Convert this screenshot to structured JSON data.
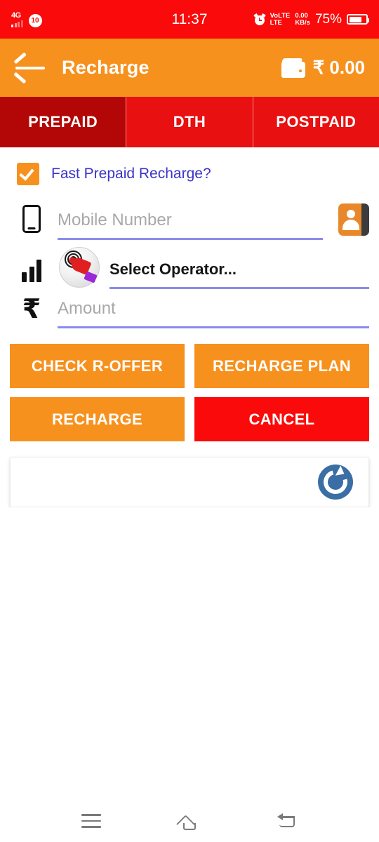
{
  "statusbar": {
    "network_type": "4G",
    "sim_badge": "10",
    "clock": "11:37",
    "alarm_icon": "alarm-clock-icon",
    "volte_line1": "VoLTE",
    "volte_line2": "LTE",
    "data_rate_value": "0.00",
    "data_rate_unit": "KB/s",
    "battery_percent": "75%",
    "battery_icon": "battery-icon"
  },
  "appbar": {
    "back_icon": "back-arrow-icon",
    "title": "Recharge",
    "wallet_icon": "wallet-icon",
    "wallet_balance": "₹ 0.00",
    "background_color": "#F7911E"
  },
  "tabs": {
    "active_index": 0,
    "active_color": "#b30707",
    "inactive_color": "#e81010",
    "items": [
      {
        "label": "PREPAID"
      },
      {
        "label": "DTH"
      },
      {
        "label": "POSTPAID"
      }
    ]
  },
  "form": {
    "fast_recharge": {
      "label": "Fast Prepaid Recharge?",
      "checked": true,
      "checkbox_color": "#F7911E",
      "label_color": "#3b33c9"
    },
    "mobile": {
      "icon": "mobile-phone-icon",
      "placeholder": "Mobile Number",
      "value": "",
      "contacts_icon": "contacts-book-icon"
    },
    "operator": {
      "icon": "signal-bars-icon",
      "picker_icon": "tap-hand-icon",
      "value": "Select Operator..."
    },
    "amount": {
      "icon": "rupee-icon",
      "placeholder": "Amount",
      "value": ""
    },
    "underline_color": "#8b8bec"
  },
  "actions": {
    "check_r_offer": "CHECK R-OFFER",
    "recharge_plan": "RECHARGE PLAN",
    "recharge": "RECHARGE",
    "cancel": "CANCEL",
    "primary_color": "#F7911E",
    "danger_color": "#fa0a0a"
  },
  "info_card": {
    "content": "",
    "refresh_icon": "refresh-icon",
    "refresh_color": "#3a6ea5"
  },
  "navbar": {
    "recents_icon": "menu-icon",
    "home_icon": "home-icon",
    "back_icon": "back-icon"
  }
}
